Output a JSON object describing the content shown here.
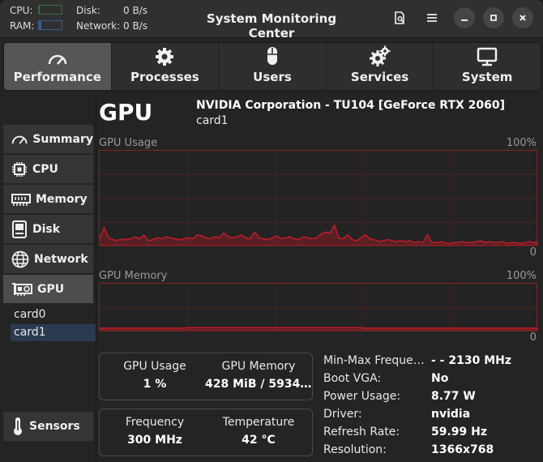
{
  "header": {
    "title": "System Monitoring Center",
    "cpu_label": "CPU:",
    "ram_label": "RAM:",
    "disk_label": "Disk:",
    "disk_value": "0 B/s",
    "network_label": "Network:",
    "network_value": "0 B/s",
    "cpu_load_fraction": 0.02,
    "ram_load_fraction": 0.12,
    "colors": {
      "cpu_bar": "#3c6e3c",
      "ram_bar": "#3c5a8a"
    }
  },
  "tabs": [
    {
      "label": "Performance",
      "icon": "speedometer-icon",
      "active": true
    },
    {
      "label": "Processes",
      "icon": "gear-icon",
      "active": false
    },
    {
      "label": "Users",
      "icon": "mouse-icon",
      "active": false
    },
    {
      "label": "Services",
      "icon": "gears-icon",
      "active": false
    },
    {
      "label": "System",
      "icon": "monitor-icon",
      "active": false
    }
  ],
  "sidebar": {
    "items": [
      {
        "label": "Summary",
        "icon": "speedometer-icon"
      },
      {
        "label": "CPU",
        "icon": "chip-icon"
      },
      {
        "label": "Memory",
        "icon": "memory-icon"
      },
      {
        "label": "Disk",
        "icon": "disk-icon"
      },
      {
        "label": "Network",
        "icon": "globe-icon"
      },
      {
        "label": "GPU",
        "icon": "gpu-icon"
      }
    ],
    "devices": [
      "card0",
      "card1"
    ],
    "selected_device": "card1",
    "sensors_label": "Sensors"
  },
  "main": {
    "title": "GPU",
    "model": "NVIDIA Corporation - TU104 [GeForce RTX 2060]",
    "card": "card1",
    "graph_usage": {
      "label": "GPU Usage",
      "max": "100%",
      "min": "0"
    },
    "graph_memory": {
      "label": "GPU Memory",
      "max": "100%",
      "min": "0"
    },
    "graph_color": "#c01c28",
    "stats": {
      "usage_label": "GPU Usage",
      "usage_value": "1 %",
      "memory_label": "GPU Memory",
      "memory_value": "428 MiB / 5934 …",
      "frequency_label": "Frequency",
      "frequency_value": "300 MHz",
      "temperature_label": "Temperature",
      "temperature_value": "42 °C"
    },
    "info": [
      {
        "key": "Min-Max Frequen…",
        "value": "- - 2130 MHz"
      },
      {
        "key": "Boot VGA:",
        "value": "No"
      },
      {
        "key": "Power Usage:",
        "value": "8.77 W"
      },
      {
        "key": "Driver:",
        "value": "nvidia"
      },
      {
        "key": "Refresh Rate:",
        "value": "59.99 Hz"
      },
      {
        "key": "Resolution:",
        "value": "1366x768"
      }
    ]
  },
  "chart_data": [
    {
      "type": "area",
      "title": "GPU Usage",
      "ylim": [
        0,
        100
      ],
      "values": [
        8,
        20,
        9,
        7,
        6,
        8,
        7,
        8,
        10,
        8,
        12,
        6,
        7,
        9,
        8,
        10,
        9,
        8,
        7,
        8,
        9,
        8,
        12,
        11,
        9,
        8,
        10,
        9,
        14,
        10,
        9,
        10,
        12,
        9,
        8,
        15,
        9,
        8,
        7,
        9,
        11,
        8,
        9,
        10,
        8,
        7,
        10,
        9,
        8,
        9,
        13,
        15,
        14,
        22,
        9,
        8,
        12,
        7,
        6,
        9,
        12,
        8,
        7,
        5,
        6,
        7,
        6,
        5,
        6,
        5,
        6,
        4,
        5,
        4,
        12,
        4,
        4,
        5,
        4,
        3,
        4,
        4,
        5,
        4,
        4,
        5,
        6,
        4,
        5,
        4,
        4,
        5,
        3,
        4,
        4,
        3,
        4,
        5,
        4,
        4
      ]
    },
    {
      "type": "area",
      "title": "GPU Memory",
      "ylim": [
        0,
        100
      ],
      "values": [
        7,
        7,
        7,
        7,
        7,
        7,
        7,
        7,
        7,
        7,
        7,
        7,
        7,
        7,
        7,
        7,
        7,
        7,
        7,
        7,
        8,
        8,
        8,
        8,
        8,
        8,
        8,
        8,
        8,
        8,
        8,
        8,
        8,
        8,
        8,
        8,
        8,
        8,
        8,
        8,
        8,
        8,
        8,
        8,
        8,
        8,
        8,
        8,
        8,
        8,
        8,
        8,
        8,
        8,
        8,
        8,
        8,
        8,
        8,
        8,
        7,
        7,
        7,
        7,
        7,
        7,
        7,
        7,
        7,
        7,
        7,
        7,
        7,
        7,
        7,
        7,
        7,
        7,
        7,
        7,
        7,
        7,
        7,
        7,
        7,
        7,
        7,
        7,
        7,
        7,
        7,
        7,
        7,
        7,
        7,
        7,
        7,
        7,
        7,
        7
      ]
    }
  ]
}
